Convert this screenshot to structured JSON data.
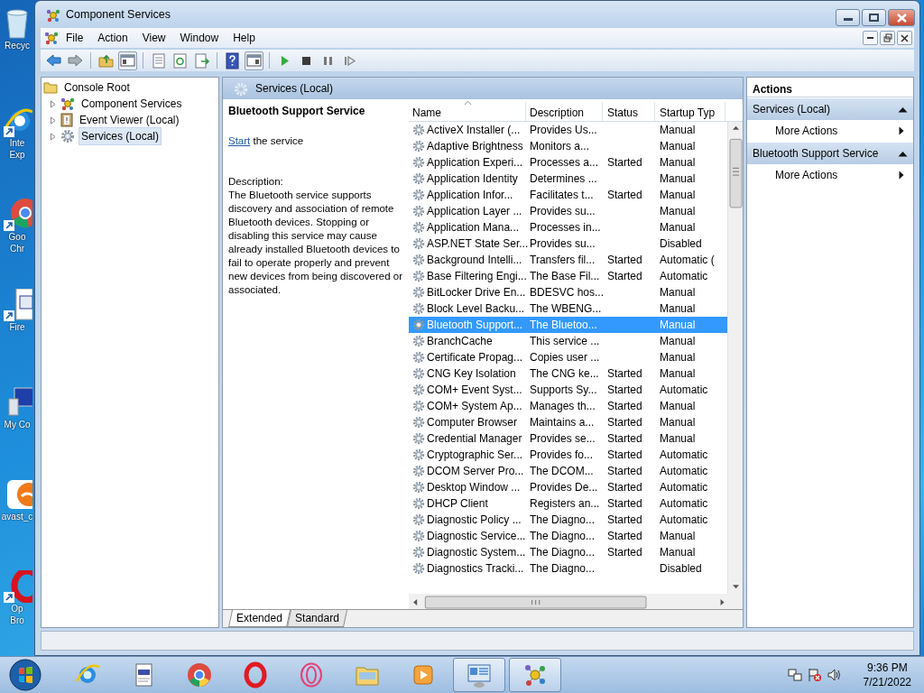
{
  "desktop_icons": [
    {
      "kind": "recycle",
      "lines": [
        "Recyc"
      ]
    },
    {
      "kind": "ie",
      "lines": [
        "Inte",
        "Exp"
      ]
    },
    {
      "kind": "chrome",
      "lines": [
        "Goo",
        "Chr"
      ]
    },
    {
      "kind": "document",
      "lines": [
        "Fire"
      ]
    },
    {
      "kind": "computer",
      "lines": [
        "My Co"
      ]
    },
    {
      "kind": "avast",
      "lines": [
        "avast_c"
      ]
    },
    {
      "kind": "opera",
      "lines": [
        "Op",
        "Bro"
      ]
    }
  ],
  "window": {
    "title": "Component Services"
  },
  "menu": [
    "File",
    "Action",
    "View",
    "Window",
    "Help"
  ],
  "tree": [
    {
      "label": "Console Root",
      "children": [
        {
          "label": "Component Services",
          "kind": "component",
          "expanded": false,
          "selected": false
        },
        {
          "label": "Event Viewer (Local)",
          "kind": "viewer",
          "expanded": false,
          "selected": false
        },
        {
          "label": "Services (Local)",
          "kind": "services",
          "expanded": false,
          "selected": true
        }
      ]
    }
  ],
  "services_panel": {
    "header": "Services (Local)",
    "service_title": "Bluetooth Support Service",
    "action_link": "Start",
    "action_text": "the service",
    "description_label": "Description:",
    "description": "The Bluetooth service supports discovery and association of remote Bluetooth devices.  Stopping or disabling this service may cause already installed Bluetooth devices to fail to operate properly and prevent new devices from being discovered or associated."
  },
  "table": {
    "columns": [
      {
        "label": "Name",
        "sorted": true
      },
      {
        "label": "Description",
        "sorted": false
      },
      {
        "label": "Status",
        "sorted": false
      },
      {
        "label": "Startup Typ",
        "sorted": false
      }
    ],
    "rows": [
      {
        "name": "ActiveX Installer (...",
        "description": "Provides Us...",
        "status": "",
        "startup": "Manual",
        "selected": false
      },
      {
        "name": "Adaptive Brightness",
        "description": "Monitors a...",
        "status": "",
        "startup": "Manual",
        "selected": false
      },
      {
        "name": "Application Experi...",
        "description": "Processes a...",
        "status": "Started",
        "startup": "Manual",
        "selected": false
      },
      {
        "name": "Application Identity",
        "description": "Determines ...",
        "status": "",
        "startup": "Manual",
        "selected": false
      },
      {
        "name": "Application Infor...",
        "description": "Facilitates t...",
        "status": "Started",
        "startup": "Manual",
        "selected": false
      },
      {
        "name": "Application Layer ...",
        "description": "Provides su...",
        "status": "",
        "startup": "Manual",
        "selected": false
      },
      {
        "name": "Application Mana...",
        "description": "Processes in...",
        "status": "",
        "startup": "Manual",
        "selected": false
      },
      {
        "name": "ASP.NET State Ser...",
        "description": "Provides su...",
        "status": "",
        "startup": "Disabled",
        "selected": false
      },
      {
        "name": "Background Intelli...",
        "description": "Transfers fil...",
        "status": "Started",
        "startup": "Automatic (",
        "selected": false
      },
      {
        "name": "Base Filtering Engi...",
        "description": "The Base Fil...",
        "status": "Started",
        "startup": "Automatic",
        "selected": false
      },
      {
        "name": "BitLocker Drive En...",
        "description": "BDESVC hos...",
        "status": "",
        "startup": "Manual",
        "selected": false
      },
      {
        "name": "Block Level Backu...",
        "description": "The WBENG...",
        "status": "",
        "startup": "Manual",
        "selected": false
      },
      {
        "name": "Bluetooth Support...",
        "description": "The Bluetoo...",
        "status": "",
        "startup": "Manual",
        "selected": true
      },
      {
        "name": "BranchCache",
        "description": "This service ...",
        "status": "",
        "startup": "Manual",
        "selected": false
      },
      {
        "name": "Certificate Propag...",
        "description": "Copies user ...",
        "status": "",
        "startup": "Manual",
        "selected": false
      },
      {
        "name": "CNG Key Isolation",
        "description": "The CNG ke...",
        "status": "Started",
        "startup": "Manual",
        "selected": false
      },
      {
        "name": "COM+ Event Syst...",
        "description": "Supports Sy...",
        "status": "Started",
        "startup": "Automatic",
        "selected": false
      },
      {
        "name": "COM+ System Ap...",
        "description": "Manages th...",
        "status": "Started",
        "startup": "Manual",
        "selected": false
      },
      {
        "name": "Computer Browser",
        "description": "Maintains a...",
        "status": "Started",
        "startup": "Manual",
        "selected": false
      },
      {
        "name": "Credential Manager",
        "description": "Provides se...",
        "status": "Started",
        "startup": "Manual",
        "selected": false
      },
      {
        "name": "Cryptographic Ser...",
        "description": "Provides fo...",
        "status": "Started",
        "startup": "Automatic",
        "selected": false
      },
      {
        "name": "DCOM Server Pro...",
        "description": "The DCOM...",
        "status": "Started",
        "startup": "Automatic",
        "selected": false
      },
      {
        "name": "Desktop Window ...",
        "description": "Provides De...",
        "status": "Started",
        "startup": "Automatic",
        "selected": false
      },
      {
        "name": "DHCP Client",
        "description": "Registers an...",
        "status": "Started",
        "startup": "Automatic",
        "selected": false
      },
      {
        "name": "Diagnostic Policy ...",
        "description": "The Diagno...",
        "status": "Started",
        "startup": "Automatic",
        "selected": false
      },
      {
        "name": "Diagnostic Service...",
        "description": "The Diagno...",
        "status": "Started",
        "startup": "Manual",
        "selected": false
      },
      {
        "name": "Diagnostic System...",
        "description": "The Diagno...",
        "status": "Started",
        "startup": "Manual",
        "selected": false
      },
      {
        "name": "Diagnostics Tracki...",
        "description": "The Diagno...",
        "status": "",
        "startup": "Disabled",
        "selected": false
      }
    ]
  },
  "view_tabs": [
    {
      "label": "Extended",
      "selected": true
    },
    {
      "label": "Standard",
      "selected": false
    }
  ],
  "actions": {
    "title": "Actions",
    "groups": [
      {
        "header": "Services (Local)",
        "items": [
          "More Actions"
        ]
      },
      {
        "header": "Bluetooth Support Service",
        "items": [
          "More Actions"
        ]
      }
    ]
  },
  "taskbar": {
    "apps": [
      {
        "kind": "ie",
        "active": false
      },
      {
        "kind": "document",
        "active": false
      },
      {
        "kind": "chrome",
        "active": false
      },
      {
        "kind": "opera",
        "active": false
      },
      {
        "kind": "opera-gx",
        "active": false
      },
      {
        "kind": "folder",
        "active": false
      },
      {
        "kind": "media",
        "active": false
      },
      {
        "kind": "console",
        "active": true
      },
      {
        "kind": "component",
        "active": true
      }
    ],
    "time": "9:36 PM",
    "date": "7/21/2022"
  }
}
